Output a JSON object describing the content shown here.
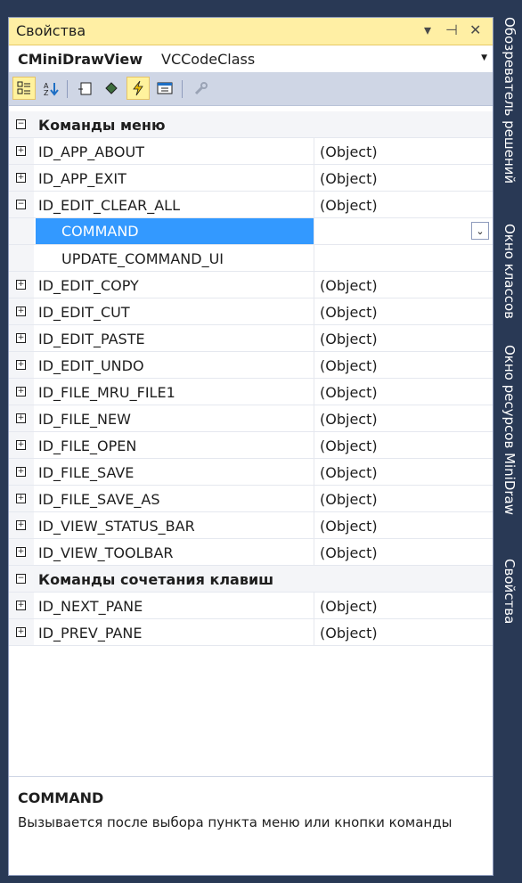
{
  "window": {
    "title": "Свойства",
    "controls": [
      "▾",
      "⊣",
      "✕"
    ]
  },
  "object_selector": {
    "name": "CMiniDrawView",
    "class": "VCCodeClass"
  },
  "toolbar": {
    "buttons": [
      {
        "name": "categorized-icon",
        "glyph": "▦"
      },
      {
        "name": "alphabetical-icon",
        "glyph": "A↓"
      },
      {
        "name": "properties-icon",
        "glyph": "▭"
      },
      {
        "name": "events-icon",
        "glyph": "◆"
      },
      {
        "name": "messages-icon",
        "glyph": "⚡"
      },
      {
        "name": "overrides-icon",
        "glyph": "▤"
      },
      {
        "name": "property-pages-icon",
        "glyph": "🔧"
      }
    ]
  },
  "grid": {
    "categories": [
      {
        "label": "Команды меню"
      },
      {
        "label": "Команды сочетания клавиш"
      }
    ],
    "rows": [
      {
        "name": "ID_APP_ABOUT",
        "value": "(Object)"
      },
      {
        "name": "ID_APP_EXIT",
        "value": "(Object)"
      },
      {
        "name": "ID_EDIT_CLEAR_ALL",
        "value": "(Object)"
      },
      {
        "name": "COMMAND",
        "value": ""
      },
      {
        "name": "UPDATE_COMMAND_UI",
        "value": ""
      },
      {
        "name": "ID_EDIT_COPY",
        "value": "(Object)"
      },
      {
        "name": "ID_EDIT_CUT",
        "value": "(Object)"
      },
      {
        "name": "ID_EDIT_PASTE",
        "value": "(Object)"
      },
      {
        "name": "ID_EDIT_UNDO",
        "value": "(Object)"
      },
      {
        "name": "ID_FILE_MRU_FILE1",
        "value": "(Object)"
      },
      {
        "name": "ID_FILE_NEW",
        "value": "(Object)"
      },
      {
        "name": "ID_FILE_OPEN",
        "value": "(Object)"
      },
      {
        "name": "ID_FILE_SAVE",
        "value": "(Object)"
      },
      {
        "name": "ID_FILE_SAVE_AS",
        "value": "(Object)"
      },
      {
        "name": "ID_VIEW_STATUS_BAR",
        "value": "(Object)"
      },
      {
        "name": "ID_VIEW_TOOLBAR",
        "value": "(Object)"
      },
      {
        "name": "ID_NEXT_PANE",
        "value": "(Object)"
      },
      {
        "name": "ID_PREV_PANE",
        "value": "(Object)"
      }
    ]
  },
  "description": {
    "title": "COMMAND",
    "text": "Вызывается после выбора пункта меню или кнопки команды"
  },
  "side_tabs": [
    "Обозреватель решений",
    "Окно классов",
    "Окно ресурсов MiniDraw",
    "Свойства"
  ],
  "colors": {
    "background": "#293955",
    "titlebar": "#ffefa4",
    "selection": "#3399ff",
    "toolbar": "#cfd6e5"
  }
}
